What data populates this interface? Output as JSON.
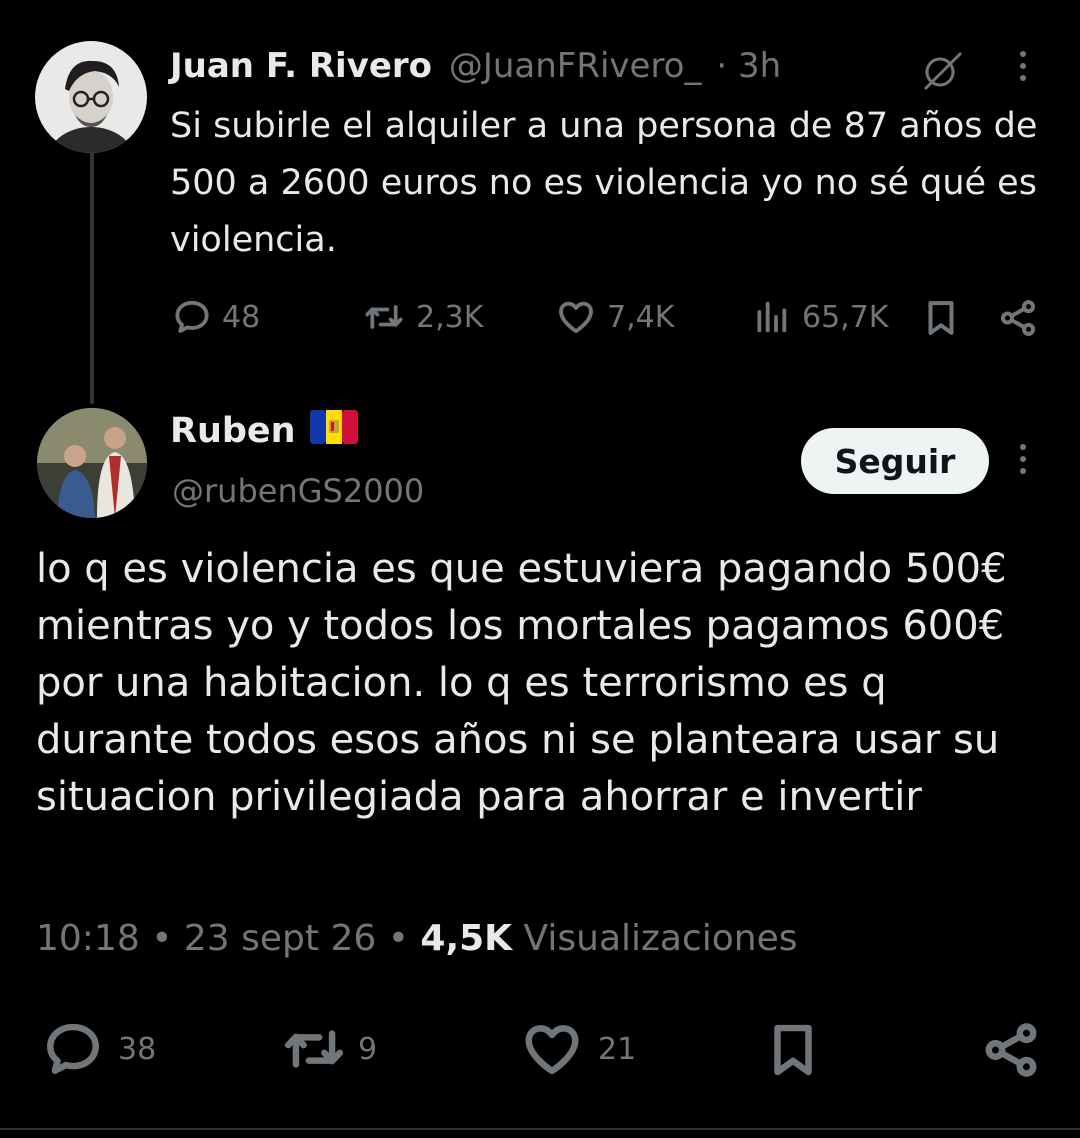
{
  "parent_tweet": {
    "author_name": "Juan F. Rivero",
    "handle": "@JuanFRivero_",
    "separator": "·",
    "time_ago": "3h",
    "text": "Si subirle el alquiler a una persona de 87 años de 500 a 2600 euros no es violencia yo no sé qué es violencia.",
    "stats": {
      "replies": "48",
      "reposts": "2,3K",
      "likes": "7,4K",
      "views": "65,7K"
    }
  },
  "reply_tweet": {
    "author_name": "Ruben",
    "flag_icon": "andorra-flag-icon",
    "handle": "@rubenGS2000",
    "follow_label": "Seguir",
    "text": "lo q es violencia es que estuviera pagando 500€ mientras yo y todos los mortales pagamos 600€ por una habitacion. lo q es terrorismo es q durante todos esos años ni se planteara usar su situacion privilegiada para ahorrar e invertir",
    "time": "10:18",
    "date": "23 sept 26",
    "views_count": "4,5K",
    "views_label": "Visualizaciones",
    "stats": {
      "replies": "38",
      "reposts": "9",
      "likes": "21"
    }
  },
  "colors": {
    "background": "#000000",
    "text": "#e7e9ea",
    "muted": "#71767b",
    "follow_bg": "#eff3f4"
  }
}
